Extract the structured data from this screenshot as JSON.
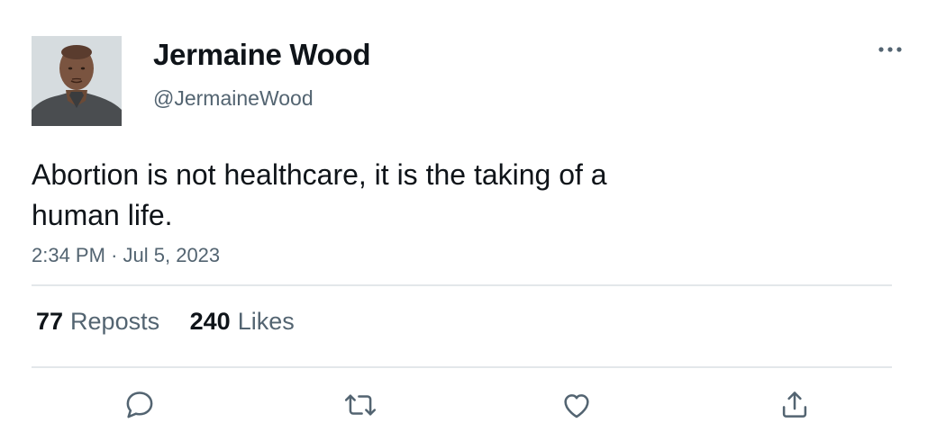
{
  "author": {
    "display_name": "Jermaine Wood",
    "handle": "@JermaineWood",
    "avatar_icon": "profile-photo"
  },
  "tweet": {
    "text": "Abortion is not healthcare, it is the taking of a human life.",
    "time": "2:34 PM",
    "separator": "·",
    "date": "Jul 5, 2023"
  },
  "stats": {
    "reposts_count": "77",
    "reposts_label": "Reposts",
    "likes_count": "240",
    "likes_label": "Likes"
  },
  "actions": {
    "reply_icon": "reply-icon",
    "repost_icon": "repost-icon",
    "like_icon": "like-icon",
    "share_icon": "share-icon",
    "more_icon": "more-icon"
  },
  "colors": {
    "text_primary": "#0f1419",
    "text_secondary": "#536471",
    "divider": "#e3e7ea",
    "background": "#ffffff"
  }
}
